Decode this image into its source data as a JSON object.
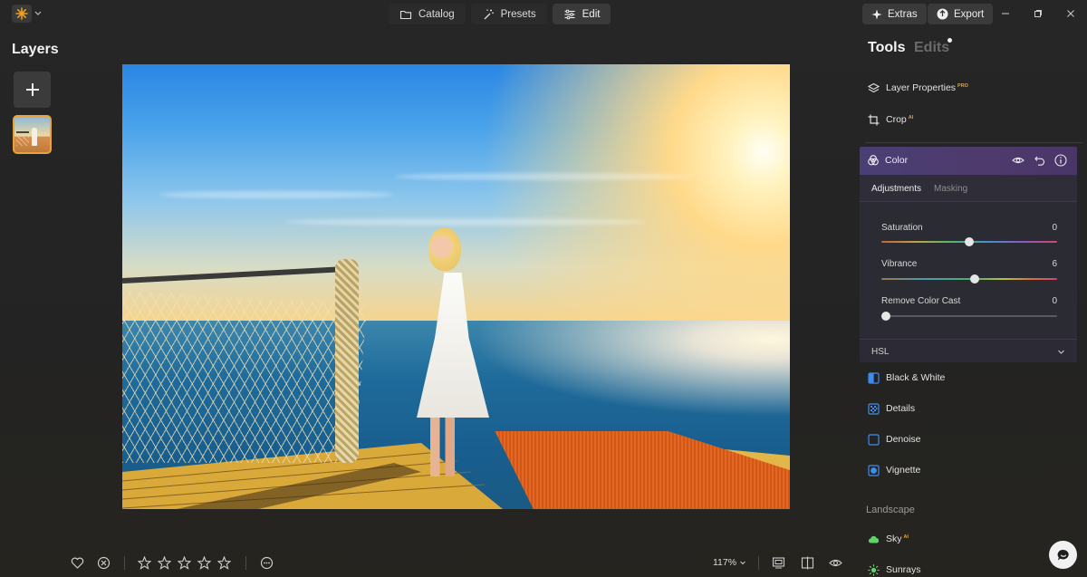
{
  "topbar": {
    "nav": [
      {
        "label": "Catalog",
        "icon": "folder-icon"
      },
      {
        "label": "Presets",
        "icon": "magic-wand-icon"
      },
      {
        "label": "Edit",
        "icon": "sliders-icon"
      }
    ],
    "active_nav": "Edit",
    "extras_label": "Extras",
    "export_label": "Export"
  },
  "layers": {
    "title": "Layers"
  },
  "right_panel": {
    "tabs": {
      "tools": "Tools",
      "edits": "Edits"
    },
    "tools": [
      {
        "label": "Layer Properties",
        "badge": "PRO",
        "icon": "layers-icon"
      },
      {
        "label": "Crop",
        "badge": "AI",
        "icon": "crop-icon"
      }
    ],
    "color": {
      "title": "Color",
      "subtabs": [
        "Adjustments",
        "Masking"
      ],
      "active_subtab": "Adjustments",
      "sliders": [
        {
          "label": "Saturation",
          "value": "0",
          "knob_pct": 50
        },
        {
          "label": "Vibrance",
          "value": "6",
          "knob_pct": 53
        },
        {
          "label": "Remove Color Cast",
          "value": "0",
          "knob_pct": 0
        }
      ],
      "hsl_label": "HSL"
    },
    "more_tools": [
      {
        "label": "Black & White",
        "icon": "black-white-icon"
      },
      {
        "label": "Details",
        "icon": "details-icon"
      },
      {
        "label": "Denoise",
        "icon": "denoise-icon"
      },
      {
        "label": "Vignette",
        "icon": "vignette-icon"
      }
    ],
    "section_landscape": "Landscape",
    "landscape_tools": [
      {
        "label": "Sky",
        "badge": "AI",
        "icon": "cloud-icon"
      },
      {
        "label": "Sunrays",
        "icon": "sun-icon"
      }
    ]
  },
  "bottombar": {
    "zoom": "117%",
    "rating_stars": 5
  },
  "colors": {
    "accent": "#e8a33a",
    "panel_header": "#4a3f74"
  }
}
